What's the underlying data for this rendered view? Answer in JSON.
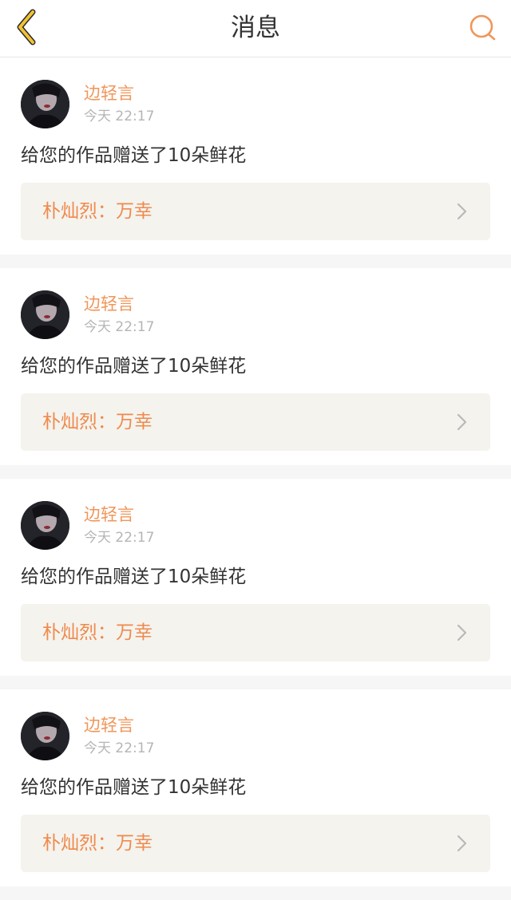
{
  "header": {
    "title": "消息",
    "back_icon": "chevron-left-icon",
    "search_icon": "search-icon"
  },
  "colors": {
    "accent": "#f0965a",
    "back_arrow": "#f2c233",
    "link_bg": "#f4f3ee"
  },
  "notifications": [
    {
      "username": "边轻言",
      "time": "今天 22:17",
      "message": "给您的作品赠送了10朵鲜花",
      "work_title": "朴灿烈：万幸"
    },
    {
      "username": "边轻言",
      "time": "今天 22:17",
      "message": "给您的作品赠送了10朵鲜花",
      "work_title": "朴灿烈：万幸"
    },
    {
      "username": "边轻言",
      "time": "今天 22:17",
      "message": "给您的作品赠送了10朵鲜花",
      "work_title": "朴灿烈：万幸"
    },
    {
      "username": "边轻言",
      "time": "今天 22:17",
      "message": "给您的作品赠送了10朵鲜花",
      "work_title": "朴灿烈：万幸"
    }
  ]
}
